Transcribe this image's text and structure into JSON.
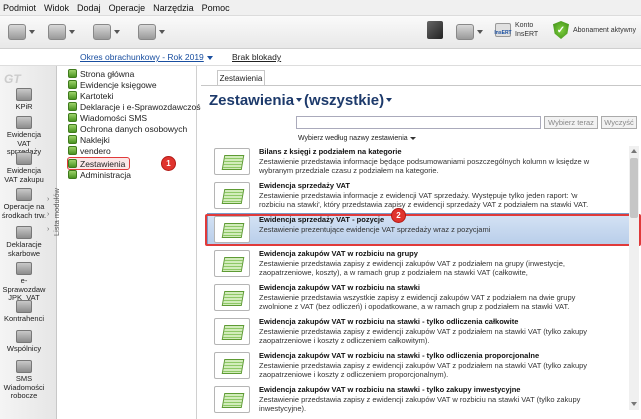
{
  "menu": [
    "Podmiot",
    "Widok",
    "Dodaj",
    "Operacje",
    "Narzędzia",
    "Pomoc"
  ],
  "toolbar": {
    "konto_line1": "Konto",
    "konto_line2": "InsERT",
    "konto_icon_text": "InsERT",
    "abonament": "Abonament aktywny"
  },
  "infobar": {
    "period": "Okres obrachunkowy - Rok 2019",
    "blokady": "Brak blokady"
  },
  "brand": "GT",
  "modules": [
    {
      "label": "KPiR",
      "icon": "kpir-icon"
    },
    {
      "label": "Ewidencja VAT sprzedaży",
      "icon": "vat-sales-icon"
    },
    {
      "label": "Ewidencja VAT zakupu",
      "icon": "vat-purchase-icon"
    },
    {
      "label": "Operacje na środkach trw.",
      "icon": "fixed-assets-icon"
    },
    {
      "label": "Deklaracje skarbowe",
      "icon": "tax-declarations-icon"
    },
    {
      "label": "e-Sprawozdaw JPK_VAT",
      "icon": "jpk-icon"
    },
    {
      "label": "Kontrahenci",
      "icon": "contractors-icon"
    },
    {
      "label": "Wspólnicy",
      "icon": "partners-icon"
    },
    {
      "label": "SMS Wiadomości robocze",
      "icon": "sms-icon"
    }
  ],
  "module_bar_label": "Lista modułów",
  "tree": [
    "Strona główna",
    "Ewidencje księgowe",
    "Kartoteki",
    "Deklaracje i e-Sprawozdawczość",
    "Wiadomości SMS",
    "Ochrona danych osobowych",
    "Naklejki",
    "vendero",
    "Zestawienia",
    "Administracja"
  ],
  "badges": {
    "one": "1",
    "two": "2"
  },
  "main": {
    "tab": "Zestawienia",
    "title": "Zestawienia",
    "filter": "(wszystkie)",
    "search_placeholder": "",
    "btn_clear": "Wybierz teraz",
    "btn_all": "Wyczyść",
    "sort_label": "Wybierz według nazwy zestawienia"
  },
  "rows": [
    {
      "title": "Bilans z księgi z podziałem na kategorie",
      "desc": "Zestawienie przedstawia informacje będące podsumowaniami poszczególnych kolumn w księdze w wybranym przedziale czasu z podziałem na kategorie."
    },
    {
      "title": "Ewidencja sprzedaży VAT",
      "desc": "Zestawienie przedstawia informacje z ewidencji VAT sprzedaży. Występuje tylko jeden raport: 'w rozbiciu na stawki', który przedstawia zapisy z ewidencji sprzedaży VAT z podziałem na stawki VAT."
    },
    {
      "title": "Ewidencja sprzedaży VAT - pozycje",
      "desc": "Zestawienie prezentujące ewidencje VAT sprzedaży wraz z pozycjami"
    },
    {
      "title": "Ewidencja zakupów VAT w rozbiciu na grupy",
      "desc": "Zestawienie przedstawia zapisy z ewidencji zakupów VAT z podziałem na grupy (inwestycje, zaopatrzeniowe, koszty), a w ramach grup z podziałem na stawki VAT (całkowite,"
    },
    {
      "title": "Ewidencja zakupów VAT w rozbiciu na stawki",
      "desc": "Zestawienie przedstawia wszystkie zapisy z ewidencji zakupów VAT z podziałem na dwie grupy zwolnione z VAT (bez odliczeń) i opodatkowane, a w ramach grup z podziałem na stawki VAT."
    },
    {
      "title": "Ewidencja zakupów VAT w rozbiciu na stawki - tylko odliczenia całkowite",
      "desc": "Zestawienie przedstawia zapisy z ewidencji zakupów VAT z podziałem na stawki VAT (tylko zakupy zaopatrzeniowe i koszty z odliczeniem całkowitym)."
    },
    {
      "title": "Ewidencja zakupów VAT w rozbiciu na stawki - tylko odliczenia proporcjonalne",
      "desc": "Zestawienie przedstawia zapisy z ewidencji zakupów VAT z podziałem na stawki VAT (tylko zakupy zaopatrzeniowe i koszty z odliczeniem proporcjonalnym)."
    },
    {
      "title": "Ewidencja zakupów VAT w rozbiciu na stawki - tylko zakupy inwestycyjne",
      "desc": "Zestawienie przedstawia zapisy z ewidencji zakupów VAT w rozbiciu na stawki VAT (tylko zakupy inwestycyjne)."
    }
  ]
}
